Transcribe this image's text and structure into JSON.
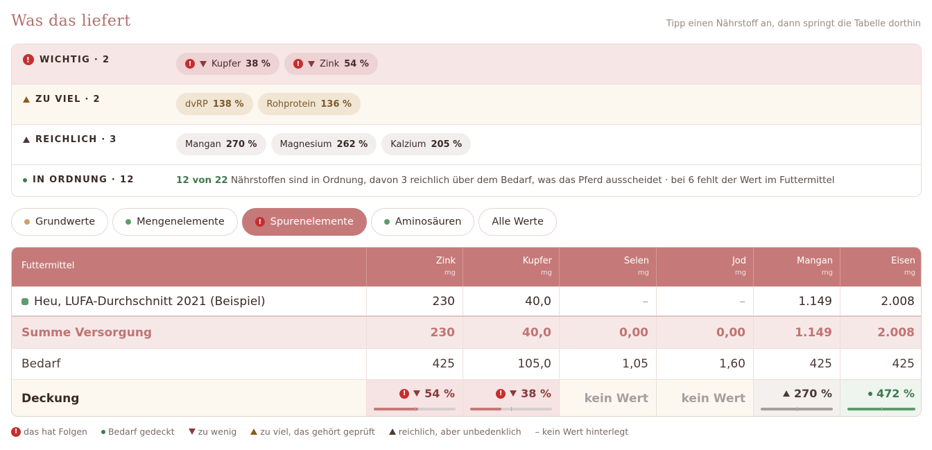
{
  "header": {
    "title": "Was das liefert",
    "hint": "Tipp einen Nährstoff an, dann springt die Tabelle dorthin"
  },
  "summary": {
    "critical": {
      "label": "WICHTIG · 2",
      "chips": [
        {
          "name": "Kupfer",
          "value": "38 %"
        },
        {
          "name": "Zink",
          "value": "54 %"
        }
      ]
    },
    "too_much": {
      "label": "ZU VIEL · 2",
      "chips": [
        {
          "name": "dvRP",
          "value": "138 %"
        },
        {
          "name": "Rohprotein",
          "value": "136 %"
        }
      ]
    },
    "plenty": {
      "label": "REICHLICH · 3",
      "chips": [
        {
          "name": "Mangan",
          "value": "270 %"
        },
        {
          "name": "Magnesium",
          "value": "262 %"
        },
        {
          "name": "Kalzium",
          "value": "205 %"
        }
      ]
    },
    "ok": {
      "label": "IN ORDNUNG · 12",
      "count_text": "12 von 22",
      "text": " Nährstoffen sind in Ordnung, davon 3 reichlich über dem Bedarf, was das Pferd ausscheidet · bei 6 fehlt der Wert im Futtermittel"
    }
  },
  "tabs": [
    {
      "label": "Grundwerte",
      "dot_color": "#c9a36a"
    },
    {
      "label": "Mengenelemente",
      "dot_color": "#5e9b6b"
    },
    {
      "label": "Spurenelemente",
      "active": true
    },
    {
      "label": "Aminosäuren",
      "dot_color": "#5e9b6b"
    },
    {
      "label": "Alle Werte"
    }
  ],
  "table": {
    "first_header": "Futtermittel",
    "columns": [
      {
        "name": "Zink",
        "unit": "mg"
      },
      {
        "name": "Kupfer",
        "unit": "mg"
      },
      {
        "name": "Selen",
        "unit": "mg"
      },
      {
        "name": "Jod",
        "unit": "mg"
      },
      {
        "name": "Mangan",
        "unit": "mg"
      },
      {
        "name": "Eisen",
        "unit": "mg"
      }
    ],
    "feed_row": {
      "label": "Heu, LUFA-Durchschnitt 2021 (Beispiel)",
      "values": [
        "230",
        "40,0",
        "–",
        "–",
        "1.149",
        "2.008"
      ]
    },
    "sum_row": {
      "label": "Summe Versorgung",
      "values": [
        "230",
        "40,0",
        "0,00",
        "0,00",
        "1.149",
        "2.008"
      ]
    },
    "need_row": {
      "label": "Bedarf",
      "values": [
        "425",
        "105,0",
        "1,05",
        "1,60",
        "425",
        "425"
      ]
    },
    "coverage_row": {
      "label": "Deckung",
      "cells": [
        {
          "status": "bad",
          "text": "54 %",
          "fraction": 0.54
        },
        {
          "status": "bad",
          "text": "38 %",
          "fraction": 0.38
        },
        {
          "status": "none",
          "text": "kein Wert"
        },
        {
          "status": "none",
          "text": "kein Wert"
        },
        {
          "status": "rich",
          "text": "270 %",
          "fraction": 1.0
        },
        {
          "status": "ok",
          "text": "472 %",
          "fraction": 1.0
        }
      ]
    }
  },
  "legend": {
    "critical": "das hat Folgen",
    "covered": "Bedarf gedeckt",
    "too_little": "zu wenig",
    "too_much": "zu viel, das gehört geprüft",
    "plenty": "reichlich, aber unbedenklich",
    "no_value": "– kein Wert hinterlegt"
  }
}
